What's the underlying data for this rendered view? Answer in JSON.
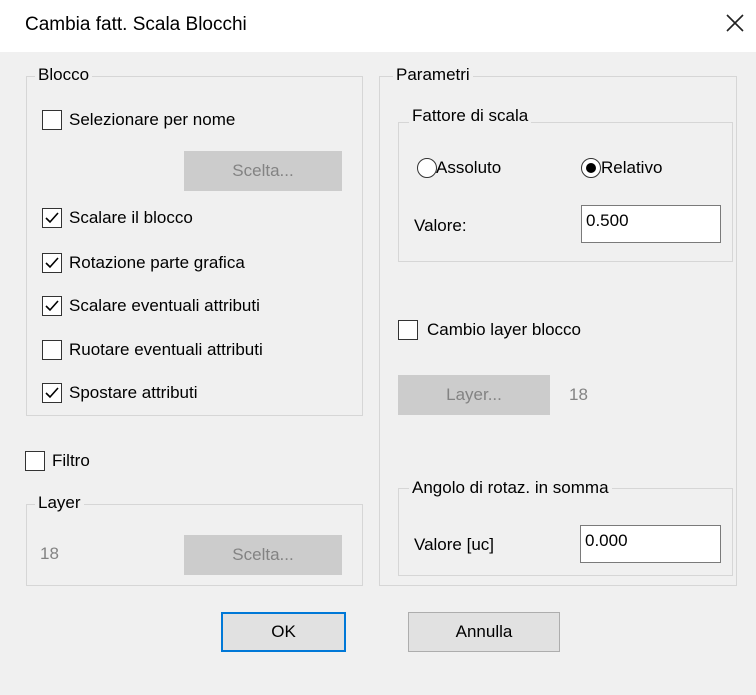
{
  "window": {
    "title": "Cambia fatt. Scala Blocchi"
  },
  "blocco": {
    "legend": "Blocco",
    "select_by_name": {
      "label": "Selezionare per nome",
      "checked": false
    },
    "choose_button": "Scelta...",
    "options": [
      {
        "label": "Scalare il blocco",
        "checked": true
      },
      {
        "label": "Rotazione parte grafica",
        "checked": true
      },
      {
        "label": "Scalare eventuali attributi",
        "checked": true
      },
      {
        "label": "Ruotare eventuali attributi",
        "checked": false
      },
      {
        "label": "Spostare attributi",
        "checked": true
      }
    ]
  },
  "filtro": {
    "label": "Filtro",
    "checked": false
  },
  "layer_group": {
    "legend": "Layer",
    "value": "18",
    "choose_button": "Scelta..."
  },
  "parametri": {
    "legend": "Parametri",
    "fattore": {
      "legend": "Fattore di scala",
      "radio_assoluto": "Assoluto",
      "radio_relativo": "Relativo",
      "selected": "Relativo",
      "value_label": "Valore:",
      "value": "0.500"
    },
    "cambio_layer": {
      "label": "Cambio layer blocco",
      "checked": false
    },
    "layer_button": "Layer...",
    "layer_value": "18",
    "angolo": {
      "legend": "Angolo di rotaz. in somma",
      "value_label": "Valore [uc]",
      "value": "0.000"
    }
  },
  "buttons": {
    "ok": "OK",
    "cancel": "Annulla"
  }
}
